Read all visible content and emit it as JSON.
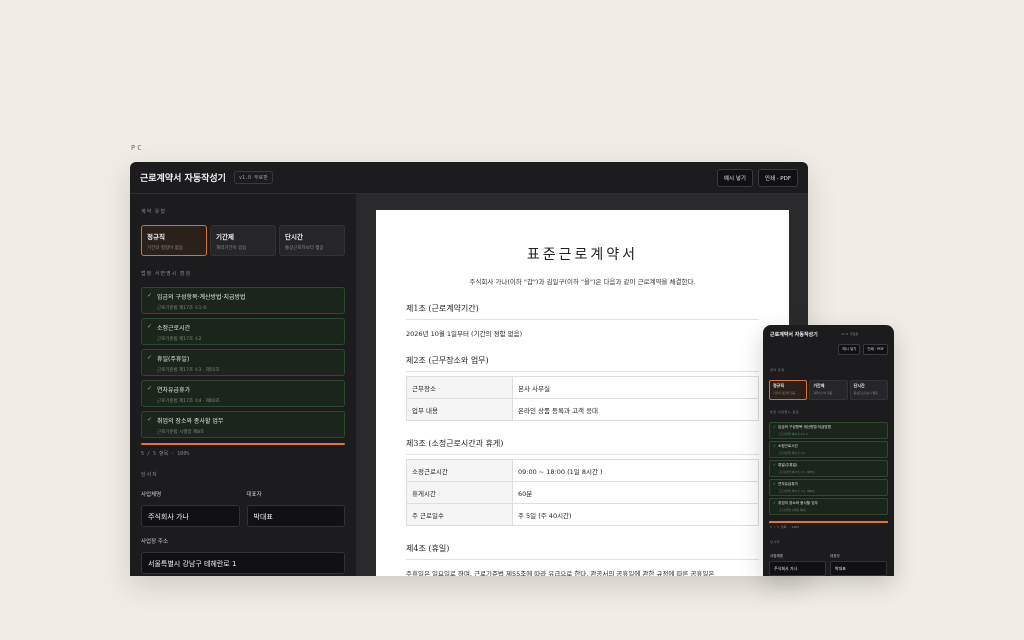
{
  "device_label": "PC",
  "app": {
    "title": "근로계약서 자동작성기",
    "version": "v1.0 무료판",
    "buttons": {
      "sample": "예시 넣기",
      "print": "인쇄 · PDF"
    }
  },
  "sidebar": {
    "contract_type_label": "계약 유형",
    "types": [
      {
        "name": "정규직",
        "desc": "기간의 정함이 없음",
        "active": true
      },
      {
        "name": "기간제",
        "desc": "계약기간이 있음",
        "active": false
      },
      {
        "name": "단시간",
        "desc": "통상근로자보다 짧음",
        "active": false
      }
    ],
    "clauses_label": "법정 서면명시 점검",
    "clauses": [
      {
        "title": "임금의 구성항목·계산방법·지급방법",
        "ref": "근로기준법 제17조 ①1·②"
      },
      {
        "title": "소정근로시간",
        "ref": "근로기준법 제17조 ①2"
      },
      {
        "title": "휴일(주휴일)",
        "ref": "근로기준법 제17조 ①3 · 제55조"
      },
      {
        "title": "연차유급휴가",
        "ref": "근로기준법 제17조 ①4 · 제60조"
      },
      {
        "title": "취업의 장소와 종사할 업무",
        "ref": "근로기준법 시행령 제8조"
      }
    ],
    "progress_text": "5 / 5 항목 · 100%",
    "progress_value": 1.0,
    "party_label": "당사자",
    "fields": {
      "company_label": "사업체명",
      "company_value": "주식회사 가나",
      "ceo_label": "대표자",
      "ceo_value": "박대표",
      "address_label": "사업장 주소",
      "address_value": "서울특별시 강남구 테헤란로 1"
    }
  },
  "document": {
    "title": "표준근로계약서",
    "intro": "주식회사 가나(이하 \"갑\")과 김일구(이하 \"을\")은 다음과 같이 근로계약을 체결한다.",
    "art1_title": "제1조 (근로계약기간)",
    "art1_text": "2026년 10월 1일부터 (기간의 정함 없음)",
    "art2_title": "제2조 (근무장소와 업무)",
    "art2_rows": [
      {
        "k": "근무장소",
        "v": "본사 사무실"
      },
      {
        "k": "업무 내용",
        "v": "온라인 상품 등록과 고객 응대"
      }
    ],
    "art3_title": "제3조 (소정근로시간과 휴게)",
    "art3_rows": [
      {
        "k": "소정근로시간",
        "v": "09:00 ~ 18:00 (1일 8시간 )"
      },
      {
        "k": "휴게시간",
        "v": "60분"
      },
      {
        "k": "주 근로일수",
        "v": "주 5일 (주 40시간)"
      }
    ],
    "art4_title": "제4조 (휴일)",
    "art4_text": "주휴일은 일요일로 하며, 근로기준법 제55조에 따라 유급으로 한다. 관공서의 공휴일에 관한 규정에 따른 공휴일은"
  },
  "mobile": {
    "title": "근로계약서 자동작성기",
    "version": "v1.0 무료판",
    "btn_sample": "예시 넣기",
    "btn_print": "인쇄 · PDF",
    "type_label": "계약 유형",
    "clauses_label": "법정 서면명시 점검",
    "party_label": "당사자",
    "progress_text": "5 / 5 항목 · 100%",
    "company_label": "사업체명",
    "company_value": "주식회사 가나",
    "ceo_label": "대표자",
    "ceo_value": "박대표"
  },
  "colors": {
    "accent": "#e07a2e",
    "check": "#5fcf6a",
    "background": "#f1ede6",
    "panel": "#1c1c1e"
  }
}
